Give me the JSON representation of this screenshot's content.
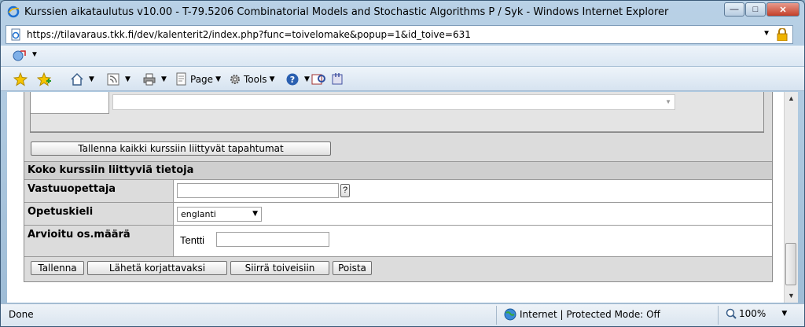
{
  "window": {
    "title": "Kurssien aikataulutus v10.00 - T-79.5206 Combinatorial Models and Stochastic Algorithms P / Syk - Windows Internet Explorer"
  },
  "address": {
    "url": "https://tilavaraus.tkk.fi/dev/kalenterit2/index.php?func=toivelomake&popup=1&id_toive=631"
  },
  "commandbar": {
    "page_label": "Page",
    "tools_label": "Tools"
  },
  "form": {
    "save_all_label": "Tallenna kaikki kurssiin liittyvät tapahtumat",
    "section_title": "Koko kurssiin liittyviä tietoja",
    "rows": {
      "teacher_label": "Vastuuopettaja",
      "teacher_value": "",
      "help_label": "?",
      "language_label": "Opetuskieli",
      "language_value": "englanti",
      "estimate_label": "Arvioitu os.määrä",
      "exam_label": "Tentti",
      "exam_value": ""
    },
    "buttons": {
      "save": "Tallenna",
      "send_for_correction": "Lähetä korjattavaksi",
      "move_to_requests": "Siirrä toiveisiin",
      "delete": "Poista"
    }
  },
  "status": {
    "text": "Done",
    "zone": "Internet | Protected Mode: Off",
    "zoom": "100%"
  }
}
